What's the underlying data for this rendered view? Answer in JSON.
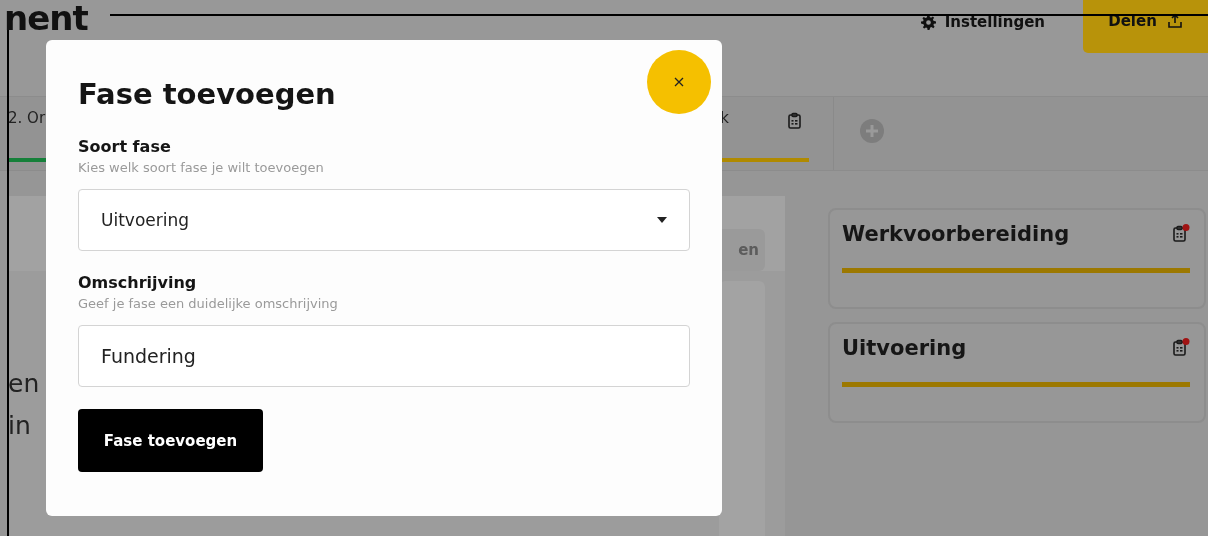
{
  "header": {
    "title_fragment": "nent",
    "settings_label": "Instellingen",
    "share_label": "Delen"
  },
  "tabs": [
    {
      "label": "2. Or",
      "color": "#16803a",
      "has_icon": false
    },
    {
      "label": "k",
      "color": "#b08a00",
      "has_icon": true
    }
  ],
  "content_fragments": {
    "button_fragment": "en",
    "text_lines": [
      "en",
      "in"
    ]
  },
  "phases": [
    {
      "title": "Werkvoorbereiding",
      "notification": true,
      "level": 1
    },
    {
      "title": "Uitvoering",
      "notification": true,
      "level": 1
    }
  ],
  "modal": {
    "title": "Fase toevoegen",
    "fields": [
      {
        "kind": "select",
        "label": "Soort fase",
        "hint": "Kies welk soort fase je wilt toevoegen",
        "value": "Uitvoering"
      },
      {
        "kind": "text",
        "label": "Omschrijving",
        "hint": "Geef je fase een duidelijke omschrijving",
        "value": "Fundering"
      }
    ],
    "submit_label": "Fase toevoegen"
  }
}
